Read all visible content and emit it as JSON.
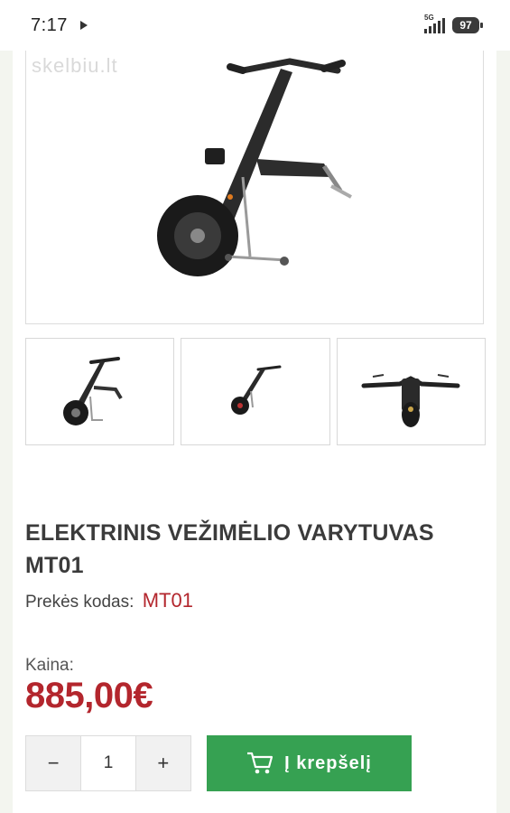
{
  "status_bar": {
    "time": "7:17",
    "network": "5G",
    "battery": "97"
  },
  "gallery": {
    "watermark": "skelbiu.lt",
    "thumbnail_count": 3
  },
  "product": {
    "title": "ELEKTRINIS VEŽIMĖLIO VARYTUVAS MT01",
    "sku_label": "Prekės kodas:",
    "sku_value": "MT01",
    "price_label": "Kaina:",
    "price": "885,00€"
  },
  "purchase": {
    "minus": "−",
    "quantity": "1",
    "plus": "+",
    "add_to_cart": "Į krepšelį"
  },
  "colors": {
    "price": "#b3262d",
    "cart_button": "#36a152"
  }
}
